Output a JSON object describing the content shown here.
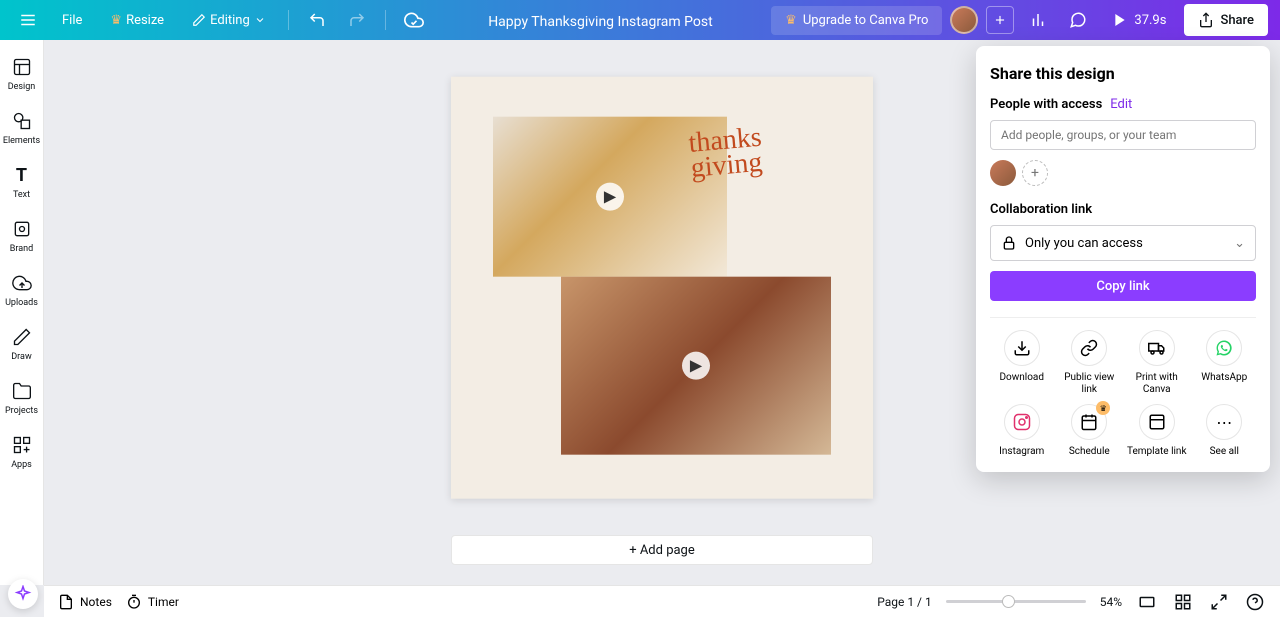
{
  "topbar": {
    "file": "File",
    "resize": "Resize",
    "editing": "Editing",
    "doc_title": "Happy Thanksgiving Instagram Post",
    "upgrade": "Upgrade to Canva Pro",
    "duration": "37.9s",
    "share": "Share"
  },
  "siderail": [
    {
      "key": "design",
      "label": "Design"
    },
    {
      "key": "elements",
      "label": "Elements"
    },
    {
      "key": "text",
      "label": "Text"
    },
    {
      "key": "brand",
      "label": "Brand"
    },
    {
      "key": "uploads",
      "label": "Uploads"
    },
    {
      "key": "draw",
      "label": "Draw"
    },
    {
      "key": "projects",
      "label": "Projects"
    },
    {
      "key": "apps",
      "label": "Apps"
    }
  ],
  "canvas": {
    "script_text": "thanks giving",
    "add_page": "+ Add page"
  },
  "bottombar": {
    "notes": "Notes",
    "timer": "Timer",
    "page_indicator": "Page 1 / 1",
    "zoom": "54%"
  },
  "share_panel": {
    "title": "Share this design",
    "people_label": "People with access",
    "edit": "Edit",
    "people_placeholder": "Add people, groups, or your team",
    "collab_label": "Collaboration link",
    "access_select": "Only you can access",
    "copy": "Copy link",
    "grid": [
      {
        "key": "download",
        "label": "Download"
      },
      {
        "key": "publicview",
        "label": "Public view link"
      },
      {
        "key": "printcanva",
        "label": "Print with Canva"
      },
      {
        "key": "whatsapp",
        "label": "WhatsApp"
      },
      {
        "key": "instagram",
        "label": "Instagram"
      },
      {
        "key": "schedule",
        "label": "Schedule"
      },
      {
        "key": "templatelink",
        "label": "Template link"
      },
      {
        "key": "seeall",
        "label": "See all"
      }
    ]
  },
  "colors": {
    "accent": "#8b3dff",
    "upgrade_crown": "#fdbc68",
    "whatsapp": "#25d366",
    "instagram": "#e1306c"
  }
}
